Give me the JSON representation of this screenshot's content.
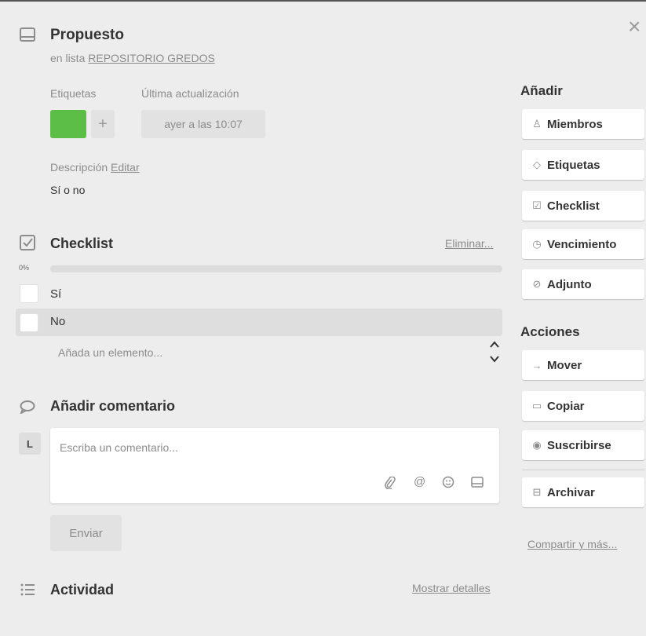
{
  "card": {
    "title": "Propuesto",
    "list_prefix": "en lista",
    "list_name": "REPOSITORIO GREDOS"
  },
  "meta": {
    "labels_heading": "Etiquetas",
    "updated_heading": "Última actualización",
    "updated_value": "ayer a las 10:07",
    "label_color": "#5cbd47",
    "add_label_symbol": "+"
  },
  "description": {
    "heading": "Descripción",
    "edit_label": "Editar",
    "text": "Sí o no"
  },
  "checklist": {
    "title": "Checklist",
    "delete_label": "Eliminar...",
    "progress_text": "0%",
    "progress": 0,
    "items": [
      {
        "label": "Sí",
        "checked": false
      },
      {
        "label": "No",
        "checked": false
      }
    ],
    "add_placeholder": "Añada un elemento..."
  },
  "comment": {
    "heading": "Añadir comentario",
    "avatar_initial": "L",
    "placeholder": "Escriba un comentario...",
    "send_label": "Enviar"
  },
  "activity": {
    "heading": "Actividad",
    "details_label": "Mostrar detalles"
  },
  "sidebar": {
    "add_heading": "Añadir",
    "add_items": [
      {
        "label": "Miembros",
        "icon": "person-icon"
      },
      {
        "label": "Etiquetas",
        "icon": "tag-icon"
      },
      {
        "label": "Checklist",
        "icon": "checklist-icon"
      },
      {
        "label": "Vencimiento",
        "icon": "clock-icon"
      },
      {
        "label": "Adjunto",
        "icon": "paperclip-icon"
      }
    ],
    "actions_heading": "Acciones",
    "action_items": [
      {
        "label": "Mover",
        "icon": "arrow-right-icon"
      },
      {
        "label": "Copiar",
        "icon": "card-icon"
      },
      {
        "label": "Suscribirse",
        "icon": "eye-icon"
      },
      {
        "label": "Archivar",
        "icon": "archive-icon"
      }
    ],
    "share_label": "Compartir y más..."
  },
  "close_symbol": "×",
  "colors": {
    "background": "#ededed",
    "label_green": "#5cbd47",
    "text": "#333333",
    "muted": "#8c8c8c"
  }
}
